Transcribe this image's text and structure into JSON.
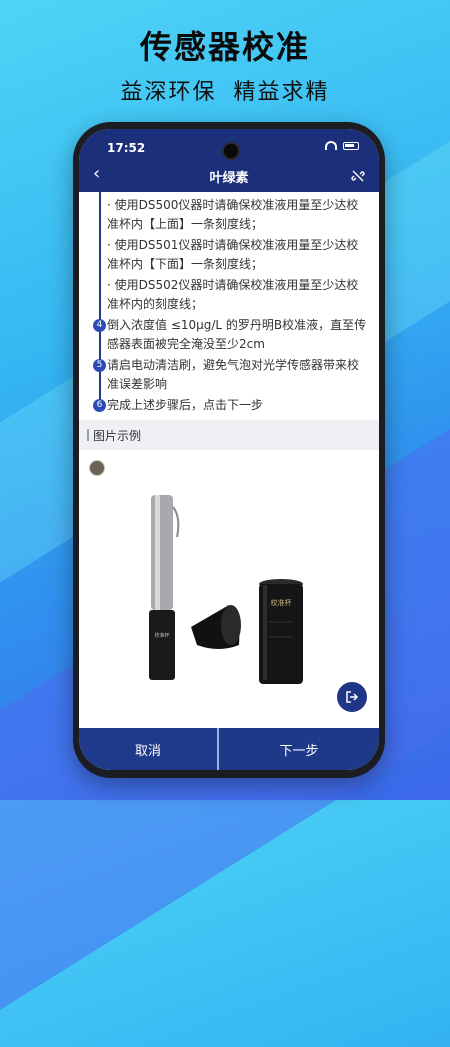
{
  "banner": {
    "title": "传感器校准",
    "subtitle": "益深环保  精益求精"
  },
  "status_bar": {
    "time": "17:52"
  },
  "nav": {
    "title": "叶绿素"
  },
  "steps": [
    {
      "number": "",
      "text": "· 使用DS500仪器时请确保校准液用量至少达校准杯内【上面】一条刻度线；"
    },
    {
      "number": "",
      "text": "· 使用DS501仪器时请确保校准液用量至少达校准杯内【下面】一条刻度线；"
    },
    {
      "number": "",
      "text": "· 使用DS502仪器时请确保校准液用量至少达校准杯内的刻度线；"
    },
    {
      "number": "4",
      "text": "倒入浓度值 ≤10μg/L 的罗丹明B校准液，直至传感器表面被完全淹没至少2cm"
    },
    {
      "number": "5",
      "text": "请启电动清洁刷，避免气泡对光学传感器带来校准误差影响"
    },
    {
      "number": "6",
      "text": "完成上述步骤后，点击下一步"
    }
  ],
  "section": {
    "title": "图片示例"
  },
  "product": {
    "cup_label": "校准杯",
    "sensor_label": "校准杯"
  },
  "buttons": {
    "cancel": "取消",
    "next": "下一步"
  },
  "colors": {
    "nav_bg": "#1b2f7a",
    "accent": "#2a4db5"
  }
}
